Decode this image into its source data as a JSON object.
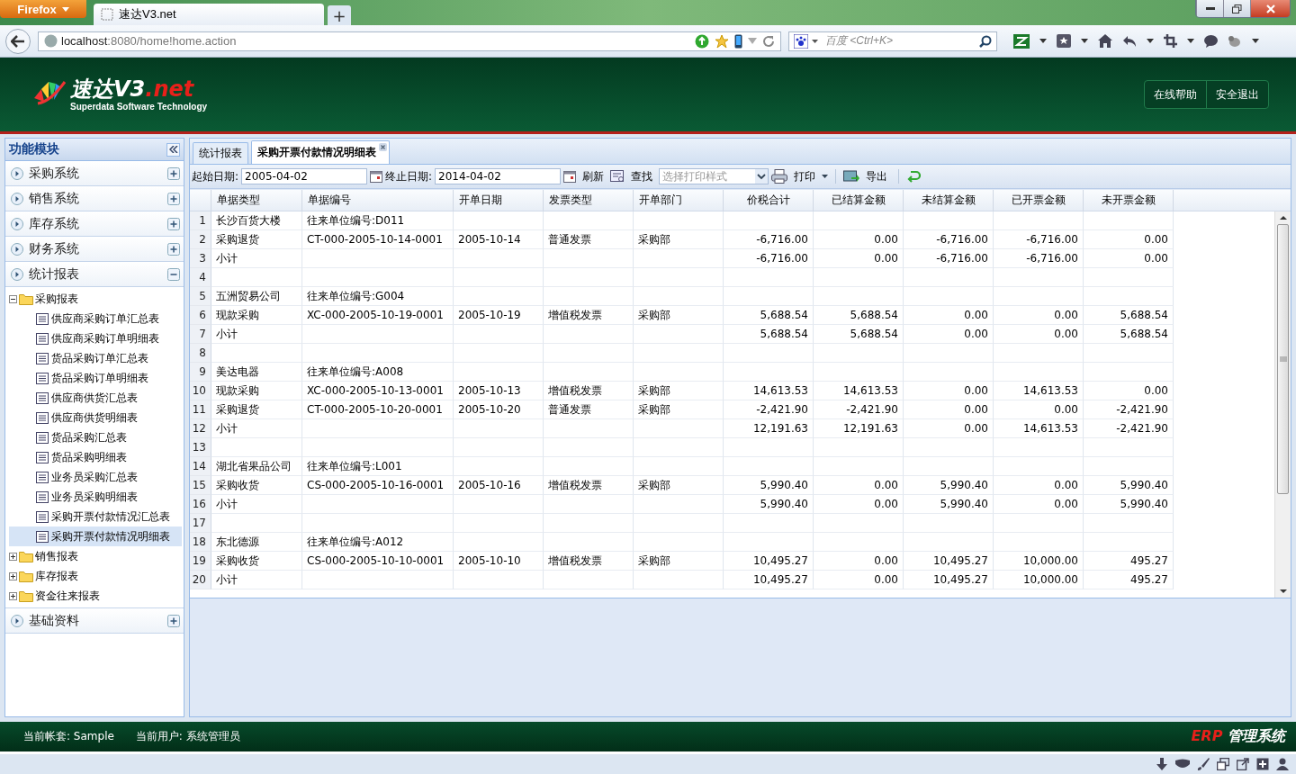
{
  "browser": {
    "menu_button": "Firefox",
    "tab_title": "速达V3.net",
    "new_tab": "+",
    "url_host": "localhost",
    "url_rest": ":8080/home!home.action",
    "search_placeholder": "百度 <Ctrl+K>"
  },
  "header": {
    "logo_title": "速达V3",
    "logo_suffix": ".net",
    "logo_tagline": "Superdata  Software Technology",
    "buttons": [
      "在线帮助",
      "安全退出"
    ]
  },
  "sidebar": {
    "title": "功能模块",
    "modules": [
      {
        "label": "采购系统",
        "expanded": false
      },
      {
        "label": "销售系统",
        "expanded": false
      },
      {
        "label": "库存系统",
        "expanded": false
      },
      {
        "label": "财务系统",
        "expanded": false
      },
      {
        "label": "统计报表",
        "expanded": true,
        "tree": [
          {
            "label": "采购报表",
            "expanded": true,
            "children": [
              {
                "label": "供应商采购订单汇总表",
                "selected": false
              },
              {
                "label": "供应商采购订单明细表",
                "selected": false
              },
              {
                "label": "货品采购订单汇总表",
                "selected": false
              },
              {
                "label": "货品采购订单明细表",
                "selected": false
              },
              {
                "label": "供应商供货汇总表",
                "selected": false
              },
              {
                "label": "供应商供货明细表",
                "selected": false
              },
              {
                "label": "货品采购汇总表",
                "selected": false
              },
              {
                "label": "货品采购明细表",
                "selected": false
              },
              {
                "label": "业务员采购汇总表",
                "selected": false
              },
              {
                "label": "业务员采购明细表",
                "selected": false
              },
              {
                "label": "采购开票付款情况汇总表",
                "selected": false
              },
              {
                "label": "采购开票付款情况明细表",
                "selected": true
              }
            ]
          },
          {
            "label": "销售报表",
            "expanded": false
          },
          {
            "label": "库存报表",
            "expanded": false
          },
          {
            "label": "资金往来报表",
            "expanded": false
          }
        ]
      },
      {
        "label": "基础资料",
        "expanded": false
      }
    ]
  },
  "tabs": [
    {
      "label": "统计报表",
      "selected": false,
      "closable": false
    },
    {
      "label": "采购开票付款情况明细表",
      "selected": true,
      "closable": true
    }
  ],
  "toolbar": {
    "start_label": "起始日期:",
    "start_value": "2005-04-02",
    "end_label": "终止日期:",
    "end_value": "2014-04-02",
    "refresh": "刷新",
    "find": "查找",
    "print_style_placeholder": "选择打印样式",
    "print": "打印",
    "export": "导出"
  },
  "table": {
    "columns": [
      "单据类型",
      "单据编号",
      "开单日期",
      "发票类型",
      "开单部门",
      "价税合计",
      "已结算金额",
      "未结算金额",
      "已开票金额",
      "未开票金额"
    ],
    "rows": [
      {
        "number": "1",
        "cells": [
          "长沙百货大楼",
          "往来单位编号:D011",
          "",
          "",
          "",
          "",
          "",
          "",
          "",
          ""
        ]
      },
      {
        "number": "2",
        "cells": [
          "采购退货",
          "CT-000-2005-10-14-0001",
          "2005-10-14",
          "普通发票",
          "采购部",
          "-6,716.00",
          "0.00",
          "-6,716.00",
          "-6,716.00",
          "0.00"
        ]
      },
      {
        "number": "3",
        "cells": [
          "小计",
          "",
          "",
          "",
          "",
          "-6,716.00",
          "0.00",
          "-6,716.00",
          "-6,716.00",
          "0.00"
        ]
      },
      {
        "number": "4",
        "cells": [
          "",
          "",
          "",
          "",
          "",
          "",
          "",
          "",
          "",
          ""
        ]
      },
      {
        "number": "5",
        "cells": [
          "五洲贸易公司",
          "往来单位编号:G004",
          "",
          "",
          "",
          "",
          "",
          "",
          "",
          ""
        ]
      },
      {
        "number": "6",
        "cells": [
          "现款采购",
          "XC-000-2005-10-19-0001",
          "2005-10-19",
          "增值税发票",
          "采购部",
          "5,688.54",
          "5,688.54",
          "0.00",
          "0.00",
          "5,688.54"
        ]
      },
      {
        "number": "7",
        "cells": [
          "小计",
          "",
          "",
          "",
          "",
          "5,688.54",
          "5,688.54",
          "0.00",
          "0.00",
          "5,688.54"
        ]
      },
      {
        "number": "8",
        "cells": [
          "",
          "",
          "",
          "",
          "",
          "",
          "",
          "",
          "",
          ""
        ]
      },
      {
        "number": "9",
        "cells": [
          "美达电器",
          "往来单位编号:A008",
          "",
          "",
          "",
          "",
          "",
          "",
          "",
          ""
        ]
      },
      {
        "number": "10",
        "cells": [
          "现款采购",
          "XC-000-2005-10-13-0001",
          "2005-10-13",
          "增值税发票",
          "采购部",
          "14,613.53",
          "14,613.53",
          "0.00",
          "14,613.53",
          "0.00"
        ]
      },
      {
        "number": "11",
        "cells": [
          "采购退货",
          "CT-000-2005-10-20-0001",
          "2005-10-20",
          "普通发票",
          "采购部",
          "-2,421.90",
          "-2,421.90",
          "0.00",
          "0.00",
          "-2,421.90"
        ]
      },
      {
        "number": "12",
        "cells": [
          "小计",
          "",
          "",
          "",
          "",
          "12,191.63",
          "12,191.63",
          "0.00",
          "14,613.53",
          "-2,421.90"
        ]
      },
      {
        "number": "13",
        "cells": [
          "",
          "",
          "",
          "",
          "",
          "",
          "",
          "",
          "",
          ""
        ]
      },
      {
        "number": "14",
        "cells": [
          "湖北省果品公司",
          "往来单位编号:L001",
          "",
          "",
          "",
          "",
          "",
          "",
          "",
          ""
        ]
      },
      {
        "number": "15",
        "cells": [
          "采购收货",
          "CS-000-2005-10-16-0001",
          "2005-10-16",
          "增值税发票",
          "采购部",
          "5,990.40",
          "0.00",
          "5,990.40",
          "0.00",
          "5,990.40"
        ]
      },
      {
        "number": "16",
        "cells": [
          "小计",
          "",
          "",
          "",
          "",
          "5,990.40",
          "0.00",
          "5,990.40",
          "0.00",
          "5,990.40"
        ]
      },
      {
        "number": "17",
        "cells": [
          "",
          "",
          "",
          "",
          "",
          "",
          "",
          "",
          "",
          ""
        ]
      },
      {
        "number": "18",
        "cells": [
          "东北德源",
          "往来单位编号:A012",
          "",
          "",
          "",
          "",
          "",
          "",
          "",
          ""
        ]
      },
      {
        "number": "19",
        "cells": [
          "采购收货",
          "CS-000-2005-10-10-0001",
          "2005-10-10",
          "增值税发票",
          "采购部",
          "10,495.27",
          "0.00",
          "10,495.27",
          "10,000.00",
          "495.27"
        ]
      },
      {
        "number": "20",
        "cells": [
          "小计",
          "",
          "",
          "",
          "",
          "10,495.27",
          "0.00",
          "10,495.27",
          "10,000.00",
          "495.27"
        ]
      }
    ]
  },
  "footer": {
    "account": "当前帐套: Sample",
    "user": "当前用户: 系统管理员",
    "brand_mark": "ERP",
    "brand_text": "管理系统"
  }
}
